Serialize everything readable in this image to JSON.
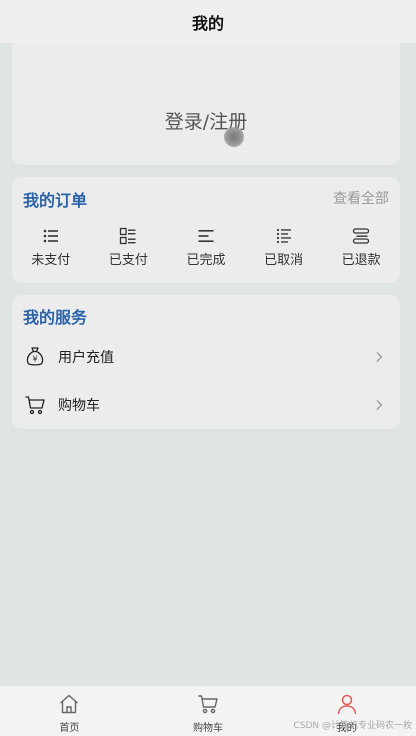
{
  "header": {
    "title": "我的"
  },
  "login": {
    "label": "登录/注册"
  },
  "orders": {
    "title": "我的订单",
    "view_all": "查看全部",
    "items": [
      {
        "label": "未支付",
        "icon": "list-icon"
      },
      {
        "label": "已支付",
        "icon": "grid-list-icon"
      },
      {
        "label": "已完成",
        "icon": "align-lines-icon"
      },
      {
        "label": "已取消",
        "icon": "checklist-icon"
      },
      {
        "label": "已退款",
        "icon": "stack-icon"
      }
    ]
  },
  "services": {
    "title": "我的服务",
    "items": [
      {
        "label": "用户充值",
        "icon": "money-bag-icon"
      },
      {
        "label": "购物车",
        "icon": "cart-icon"
      }
    ]
  },
  "tabbar": {
    "items": [
      {
        "label": "首页",
        "icon": "home-icon"
      },
      {
        "label": "购物车",
        "icon": "cart-icon"
      },
      {
        "label": "我的",
        "icon": "user-icon"
      }
    ],
    "active_color": "#e05a5a"
  },
  "watermark": "CSDN @计算机专业码农一枚"
}
